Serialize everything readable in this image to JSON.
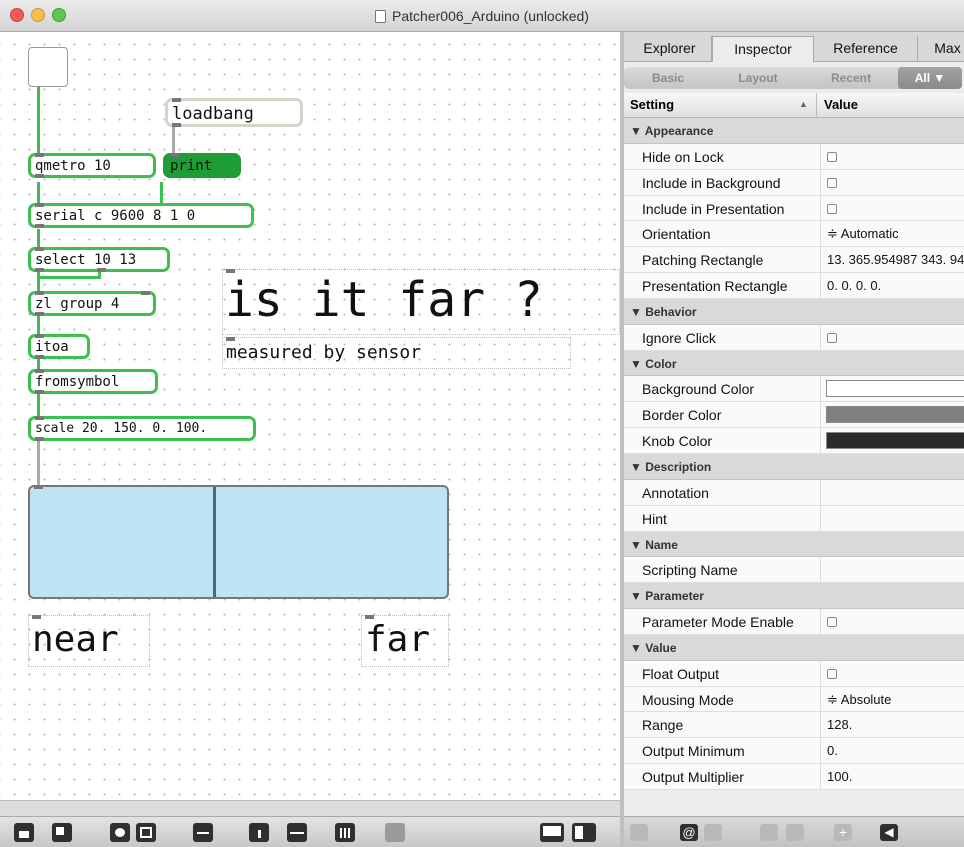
{
  "window": {
    "title": "Patcher006_Arduino (unlocked)"
  },
  "patcher": {
    "objects": {
      "loadbang": "loadbang",
      "qmetro": "qmetro 10",
      "print": "print",
      "serial": "serial c 9600 8 1 0",
      "select": "select 10 13",
      "zl": "zl group 4",
      "itoa": "itoa",
      "fromsymbol": "fromsymbol",
      "scale": "scale 20. 150. 0. 100."
    },
    "comments": {
      "big_title": "is it far ?",
      "subtitle": "measured by sensor",
      "near": "near",
      "far": "far"
    },
    "slider_value_fraction": 0.44
  },
  "inspector": {
    "tabs": [
      "Explorer",
      "Inspector",
      "Reference",
      "Max"
    ],
    "active_tab": "Inspector",
    "subtabs": [
      "Basic",
      "Layout",
      "Recent",
      "All ▼"
    ],
    "active_subtab": "All ▼",
    "header": {
      "setting": "Setting",
      "value": "Value",
      "sort_icon": "sort-ascending-icon"
    },
    "rows": [
      {
        "type": "section",
        "label": "▼ Appearance"
      },
      {
        "type": "check",
        "label": "Hide on Lock",
        "checked": false
      },
      {
        "type": "check",
        "label": "Include in Background",
        "checked": false
      },
      {
        "type": "check",
        "label": "Include in Presentation",
        "checked": false
      },
      {
        "type": "text",
        "label": "Orientation",
        "value": "≑ Automatic"
      },
      {
        "type": "text",
        "label": "Patching Rectangle",
        "value": "13. 365.954987 343. 94"
      },
      {
        "type": "text",
        "label": "Presentation Rectangle",
        "value": "0. 0. 0. 0."
      },
      {
        "type": "section",
        "label": "▼ Behavior"
      },
      {
        "type": "check",
        "label": "Ignore Click",
        "checked": false
      },
      {
        "type": "section",
        "label": "▼ Color"
      },
      {
        "type": "color",
        "label": "Background Color",
        "color": "#ffffff"
      },
      {
        "type": "color",
        "label": "Border Color",
        "color": "#7f7f7f"
      },
      {
        "type": "color",
        "label": "Knob Color",
        "color": "#2b2b2b"
      },
      {
        "type": "section",
        "label": "▼ Description"
      },
      {
        "type": "text",
        "label": "Annotation",
        "value": ""
      },
      {
        "type": "text",
        "label": "Hint",
        "value": ""
      },
      {
        "type": "section",
        "label": "▼ Name"
      },
      {
        "type": "text",
        "label": "Scripting Name",
        "value": ""
      },
      {
        "type": "section",
        "label": "▼ Parameter"
      },
      {
        "type": "check",
        "label": "Parameter Mode Enable",
        "checked": false
      },
      {
        "type": "section",
        "label": "▼ Value"
      },
      {
        "type": "check",
        "label": "Float Output",
        "checked": false
      },
      {
        "type": "text",
        "label": "Mousing Mode",
        "value": "≑ Absolute"
      },
      {
        "type": "text",
        "label": "Range",
        "value": "128."
      },
      {
        "type": "text",
        "label": "Output Minimum",
        "value": "0."
      },
      {
        "type": "text",
        "label": "Output Multiplier",
        "value": "100."
      }
    ]
  },
  "toolbar": {
    "left_icons": [
      "lock-icon",
      "new-object-icon",
      "new-button-icon",
      "new-toggle-icon",
      "new-function-icon",
      "info-icon",
      "slider-icon",
      "grid-icon",
      "paint-icon",
      "patching-mode-icon",
      "presentation-mode-icon"
    ],
    "right_icons": [
      "settings-icon",
      "at-icon",
      "list-icon",
      "snowflake-icon",
      "gear-icon",
      "add-icon",
      "back-icon"
    ]
  }
}
